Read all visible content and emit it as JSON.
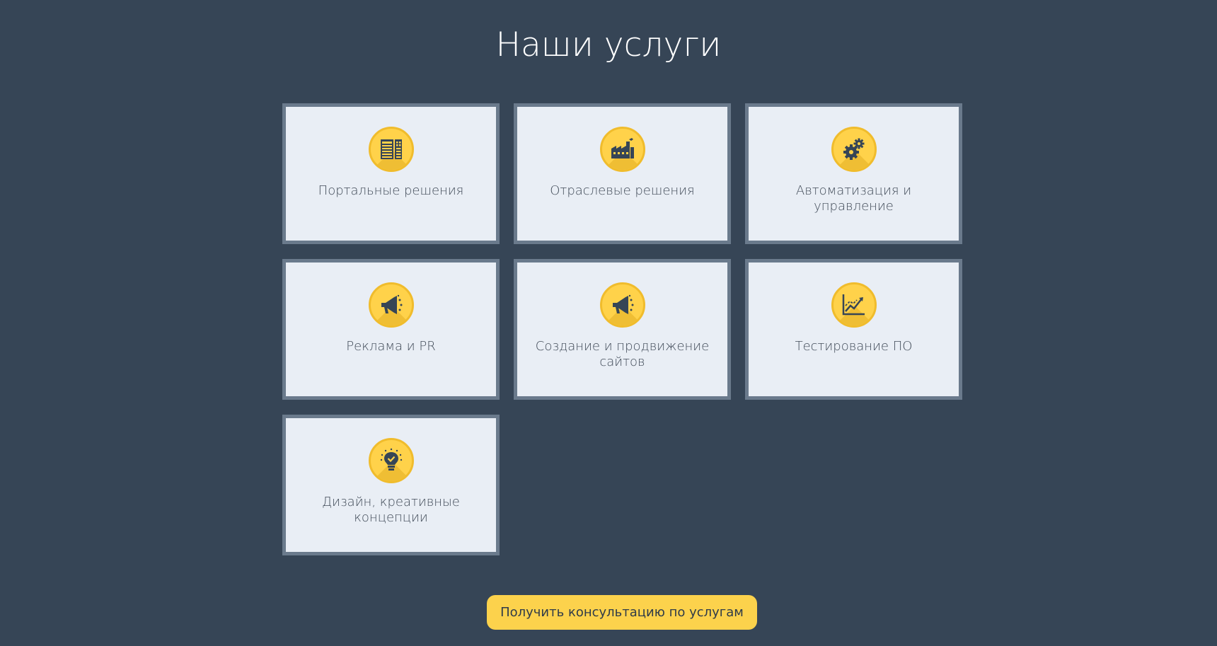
{
  "header": {
    "title": "Наши услуги"
  },
  "services": [
    {
      "label": "Портальные решения",
      "icon": "portal-grid-icon"
    },
    {
      "label": "Отраслевые решения",
      "icon": "factory-icon"
    },
    {
      "label": "Автоматизация и управление",
      "icon": "gears-icon"
    },
    {
      "label": "Реклама и PR",
      "icon": "megaphone-icon"
    },
    {
      "label": "Создание и продвижение сайтов",
      "icon": "megaphone-icon"
    },
    {
      "label": "Тестирование ПО",
      "icon": "growth-chart-icon"
    },
    {
      "label": "Дизайн, креативные концепции",
      "icon": "lightbulb-icon"
    }
  ],
  "cta": {
    "label": "Получить консультацию по услугам"
  },
  "colors": {
    "background": "#364556",
    "card": "#e9eef5",
    "card_border": "#6a7a8c",
    "accent": "#fcd24c",
    "icon_dark": "#364556"
  }
}
